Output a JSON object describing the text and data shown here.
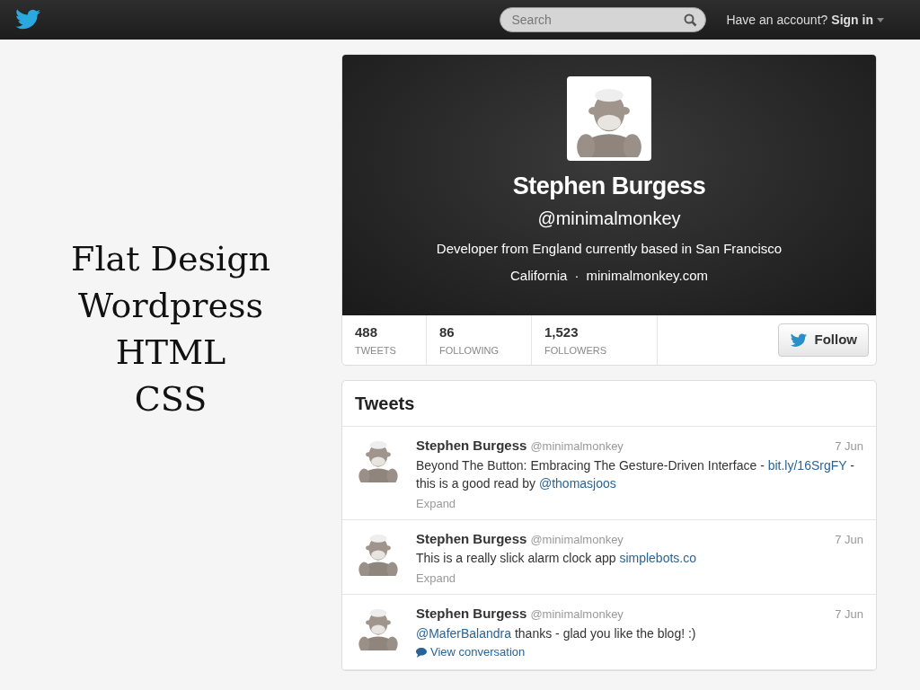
{
  "slide_text": [
    "Flat Design",
    "Wordpress",
    "HTML",
    "CSS"
  ],
  "topbar": {
    "search": {
      "placeholder": "Search"
    },
    "account_prompt": "Have an account?",
    "sign_in": "Sign in"
  },
  "profile": {
    "name": "Stephen Burgess",
    "handle": "@minimalmonkey",
    "bio": "Developer from England currently based in San Francisco",
    "location": "California",
    "separator": "·",
    "website": "minimalmonkey.com",
    "stats": [
      {
        "value": "488",
        "label": "TWEETS"
      },
      {
        "value": "86",
        "label": "FOLLOWING"
      },
      {
        "value": "1,523",
        "label": "FOLLOWERS"
      }
    ],
    "follow_button": "Follow"
  },
  "tweets": {
    "title": "Tweets",
    "items": [
      {
        "name": "Stephen Burgess",
        "handle": "@minimalmonkey",
        "date": "7 Jun",
        "text": [
          {
            "kind": "text",
            "text": "Beyond The Button: Embracing The Gesture-Driven Interface - "
          },
          {
            "kind": "link",
            "text": "bit.ly/16SrgFY"
          },
          {
            "kind": "text",
            "text": " - this is a good read by "
          },
          {
            "kind": "link",
            "text": "@thomasjoos"
          }
        ],
        "action": {
          "kind": "expand",
          "label": "Expand"
        }
      },
      {
        "name": "Stephen Burgess",
        "handle": "@minimalmonkey",
        "date": "7 Jun",
        "text": [
          {
            "kind": "text",
            "text": "This is a really slick alarm clock app "
          },
          {
            "kind": "link",
            "text": "simplebots.co"
          }
        ],
        "action": {
          "kind": "expand",
          "label": "Expand"
        }
      },
      {
        "name": "Stephen Burgess",
        "handle": "@minimalmonkey",
        "date": "7 Jun",
        "text": [
          {
            "kind": "link",
            "text": "@MaferBalandra"
          },
          {
            "kind": "text",
            "text": " thanks - glad you like the blog! :)"
          }
        ],
        "action": {
          "kind": "conversation",
          "label": "View conversation"
        }
      }
    ]
  }
}
